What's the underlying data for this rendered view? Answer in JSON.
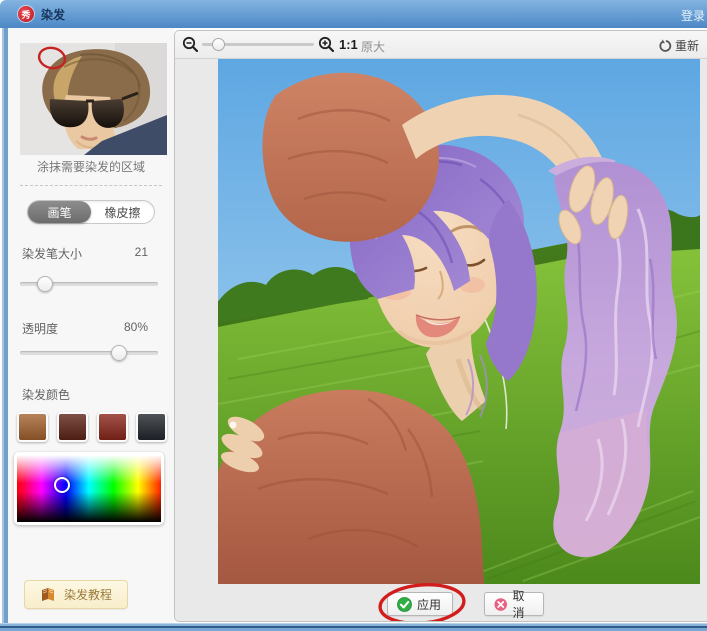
{
  "window": {
    "title": "染发",
    "badge": "秀",
    "login": "登录"
  },
  "colors": {
    "titlebar_blue": "#4c88c5",
    "annotation_red": "#d31d1d",
    "apply_green": "#2fae44",
    "cancel_pink": "#e76283"
  },
  "sidebar": {
    "thumbnail_caption": "涂抹需要染发的区域",
    "brush_tab": "画笔",
    "eraser_tab": "橡皮擦",
    "brush_size_label": "染发笔大小",
    "brush_size_value": "21",
    "brush_size_percent": "18%",
    "opacity_label": "透明度",
    "opacity_value": "80%",
    "opacity_percent": "72%",
    "dye_color_label": "染发颜色",
    "swatches": [
      "#a5632e",
      "#5f2417",
      "#8c271c",
      "#23272e"
    ],
    "tutorial_label": "染发教程"
  },
  "toolbar": {
    "zoom_ratio": "1:1",
    "zoom_ratio_suffix": "原大",
    "zoom_percent": "14%",
    "redo_label": "重新"
  },
  "footer": {
    "apply_label": "应用",
    "cancel_label": "取消"
  }
}
